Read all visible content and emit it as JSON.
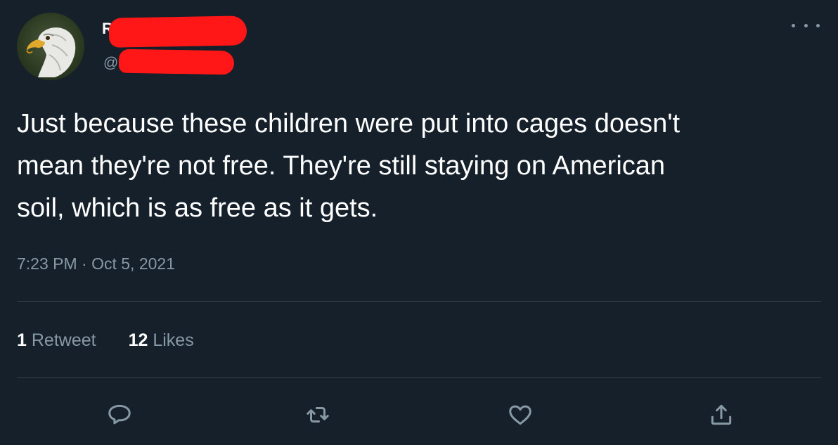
{
  "author": {
    "display_name": "R",
    "handle": "@"
  },
  "tweet": {
    "text": "Just because these children were put into cages doesn't\nmean they're not free. They're still staying on American\nsoil, which is as free as it gets.",
    "timestamp": "7:23 PM · Oct 5, 2021"
  },
  "stats": {
    "retweets_count": "1",
    "retweets_label": "Retweet",
    "likes_count": "12",
    "likes_label": "Likes"
  },
  "actions": {
    "reply_icon": "reply-icon",
    "retweet_icon": "retweet-icon",
    "like_icon": "heart-icon",
    "share_icon": "share-icon"
  },
  "colors": {
    "background": "#15202b",
    "text": "#ffffff",
    "secondary_text": "#8899a6",
    "divider": "#38444d",
    "redaction": "#ff1616"
  }
}
